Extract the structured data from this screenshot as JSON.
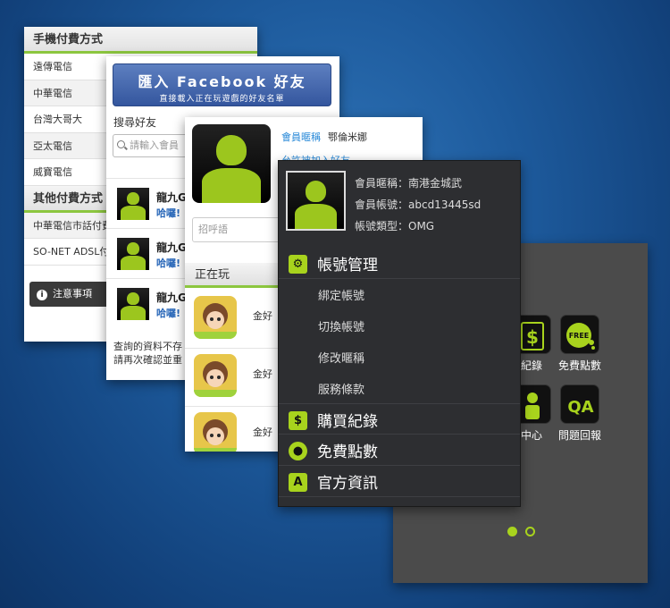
{
  "payment": {
    "mobile_title": "手機付費方式",
    "mobile_items": [
      "遠傳電信",
      "中華電信",
      "台灣大哥大",
      "亞太電信",
      "威寶電信"
    ],
    "other_title": "其他付費方式",
    "other_items": [
      "中華電信市話付費",
      "SO-NET ADSL付"
    ],
    "notice_label": "注意事項"
  },
  "facebook": {
    "button_title": "匯入 Facebook 好友",
    "button_sub": "直接載入正在玩遊戲的好友名單",
    "search_label": "搜尋好友",
    "search_placeholder": "請輸入會員",
    "friends": [
      {
        "name": "龍九G",
        "greeting": "哈囉!"
      },
      {
        "name": "龍九G",
        "greeting": "哈囉!"
      },
      {
        "name": "龍九G",
        "greeting": "哈囉!"
      }
    ],
    "bottom_line1": "查詢的資料不存",
    "bottom_line2": "請再次確認並重"
  },
  "profile": {
    "nick_key": "會員暱稱",
    "nick_value": "鄂倫米娜",
    "link_text": "允許被加入好友",
    "greeting_placeholder": "招呼語",
    "playing_title": "正在玩",
    "games": [
      {
        "name": "金好"
      },
      {
        "name": "金好"
      },
      {
        "name": "金好"
      }
    ]
  },
  "menu": {
    "nickname": "會員暱稱：南港金城武",
    "account": "會員帳號：abcd13445sd",
    "type": "帳號類型：OMG",
    "account_mgmt": "帳號管理",
    "sub_items": [
      "綁定帳號",
      "切換帳號",
      "修改暱稱",
      "服務條款"
    ],
    "purchase": "購買紀錄",
    "free_points": "免費點數",
    "official": "官方資訊"
  },
  "grid": {
    "tiles": [
      {
        "label": "紀錄"
      },
      {
        "label": "免費點數"
      },
      {
        "label": "中心"
      },
      {
        "label": "問題回報"
      }
    ],
    "free_badge": "FREE",
    "qa_badge": "QA"
  },
  "colors": {
    "accent": "#a8d31d",
    "link": "#2a8ad8"
  }
}
